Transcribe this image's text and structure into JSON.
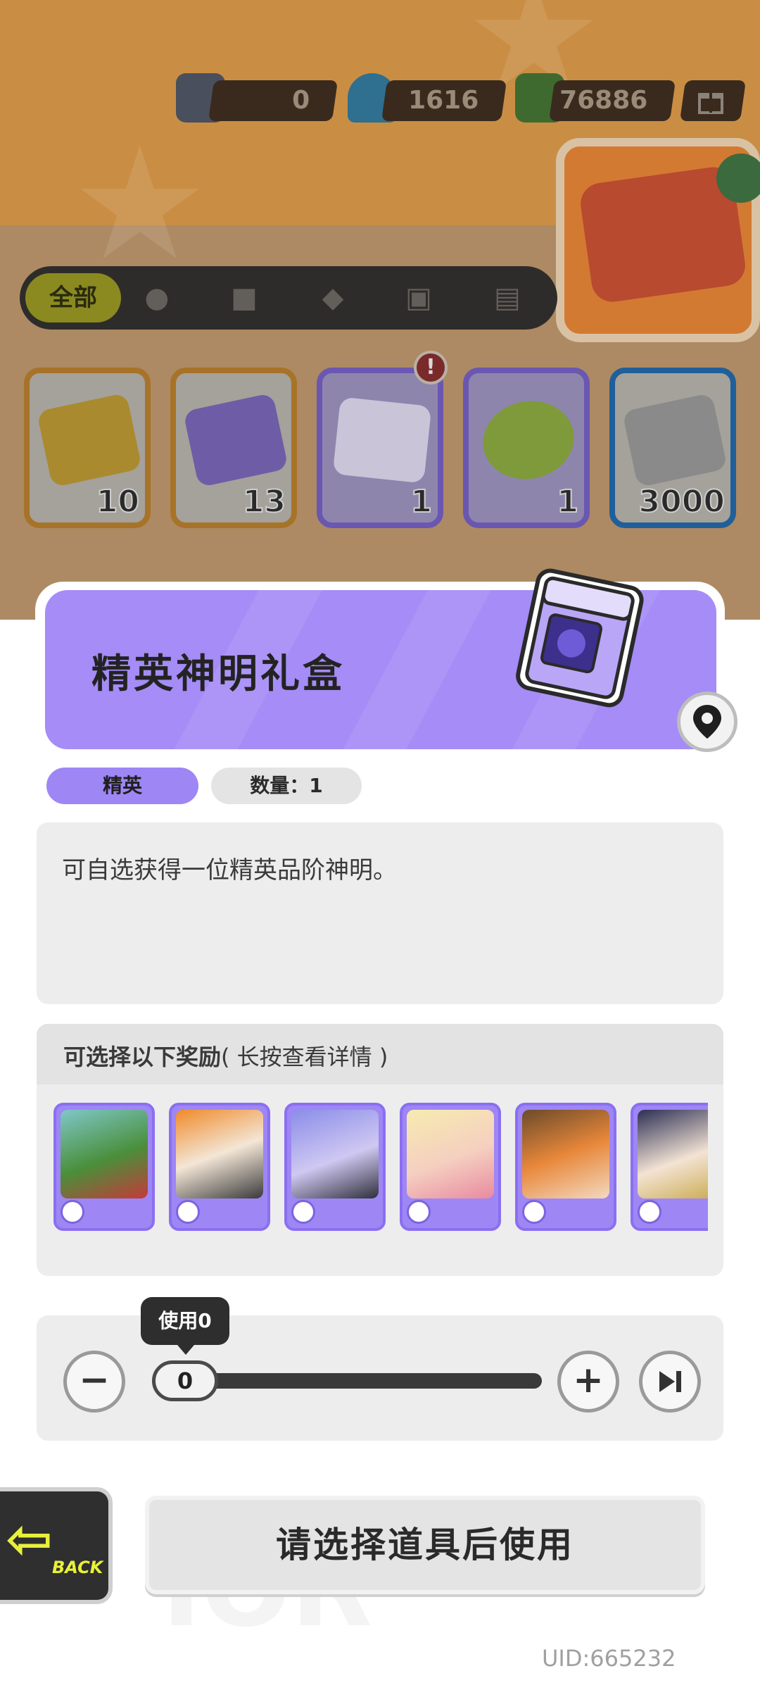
{
  "currencies": [
    {
      "name": "spray-can",
      "value": "0"
    },
    {
      "name": "diamond",
      "value": "1616"
    },
    {
      "name": "cash",
      "value": "76886"
    }
  ],
  "filters": {
    "all_label": "全部",
    "icons": [
      "person-icon",
      "box-icon",
      "card-icon",
      "dice-icon",
      "book-icon"
    ]
  },
  "items": [
    {
      "count": "10",
      "color": "#d48a00"
    },
    {
      "count": "13",
      "color": "#d48a00"
    },
    {
      "count": "1",
      "color": "#6a53b8"
    },
    {
      "count": "1",
      "color": "#6a53b8"
    },
    {
      "count": "3000",
      "color": "#1f6bb0"
    }
  ],
  "alert_mark": "!",
  "detail": {
    "title": "精英神明礼盒",
    "rarity": "精英",
    "quantity": "数量：1",
    "description": "可自选获得一位精英品阶神明。",
    "reward_title": "可选择以下奖励",
    "reward_hint": "( 长按查看详情 )"
  },
  "slider": {
    "tooltip": "使用0",
    "value": "0",
    "minus": "−",
    "plus": "+"
  },
  "back_label": "BACK",
  "use_button": "请选择道具后使用",
  "uid": "UID:665232",
  "colors": {
    "accent_purple": "#a58cf7",
    "panel_gray": "#ededed",
    "back_yellow": "#e8f03a"
  }
}
